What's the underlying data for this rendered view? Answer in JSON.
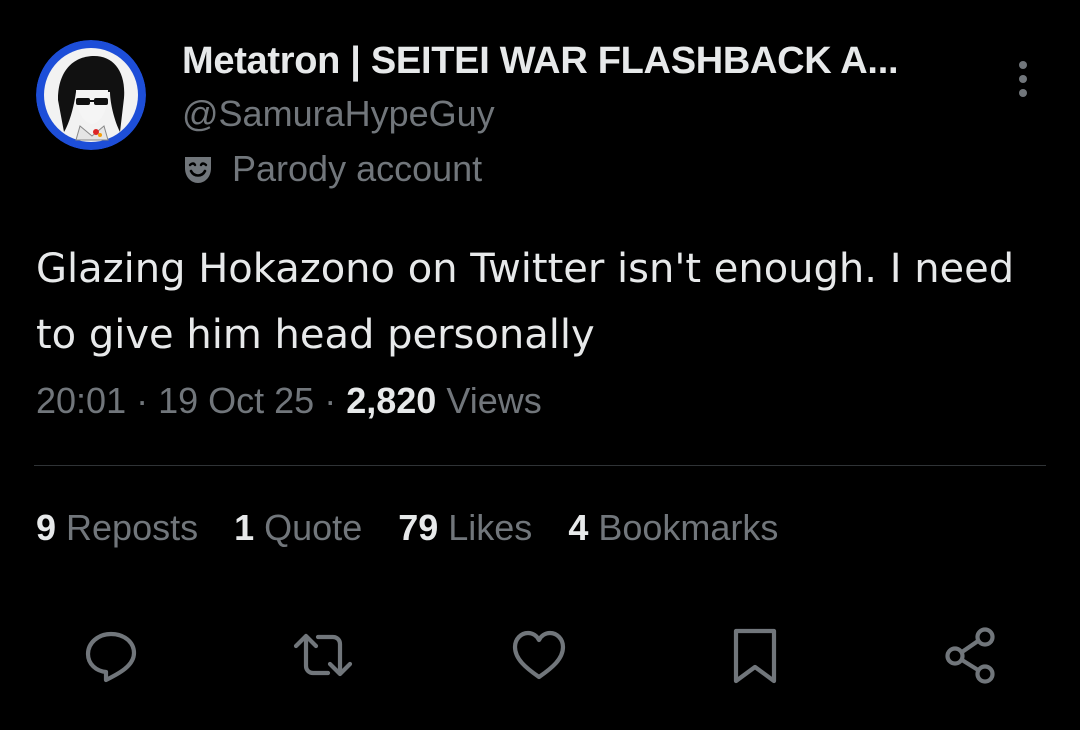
{
  "author": {
    "display_name": "Metatron | SEITEI WAR FLASHBACK A...",
    "handle": "@SamuraHypeGuy",
    "label": "Parody account",
    "label_icon": "theater-masks-icon",
    "avatar_ring_color": "#1d4ed8"
  },
  "tweet": {
    "text": "Glazing Hokazono on Twitter isn't enough. I need to give him head personally",
    "time": "20:01",
    "date": "19 Oct 25",
    "views_count": "2,820",
    "views_label": "Views"
  },
  "stats": {
    "reposts_count": "9",
    "reposts_label": "Reposts",
    "quotes_count": "1",
    "quotes_label": "Quote",
    "likes_count": "79",
    "likes_label": "Likes",
    "bookmarks_count": "4",
    "bookmarks_label": "Bookmarks"
  },
  "actions": [
    "reply-icon",
    "repost-icon",
    "like-icon",
    "bookmark-icon",
    "share-icon"
  ],
  "colors": {
    "background": "#000000",
    "primary_text": "#e7e9ea",
    "secondary_text": "#71767b",
    "divider": "#2f3336"
  }
}
